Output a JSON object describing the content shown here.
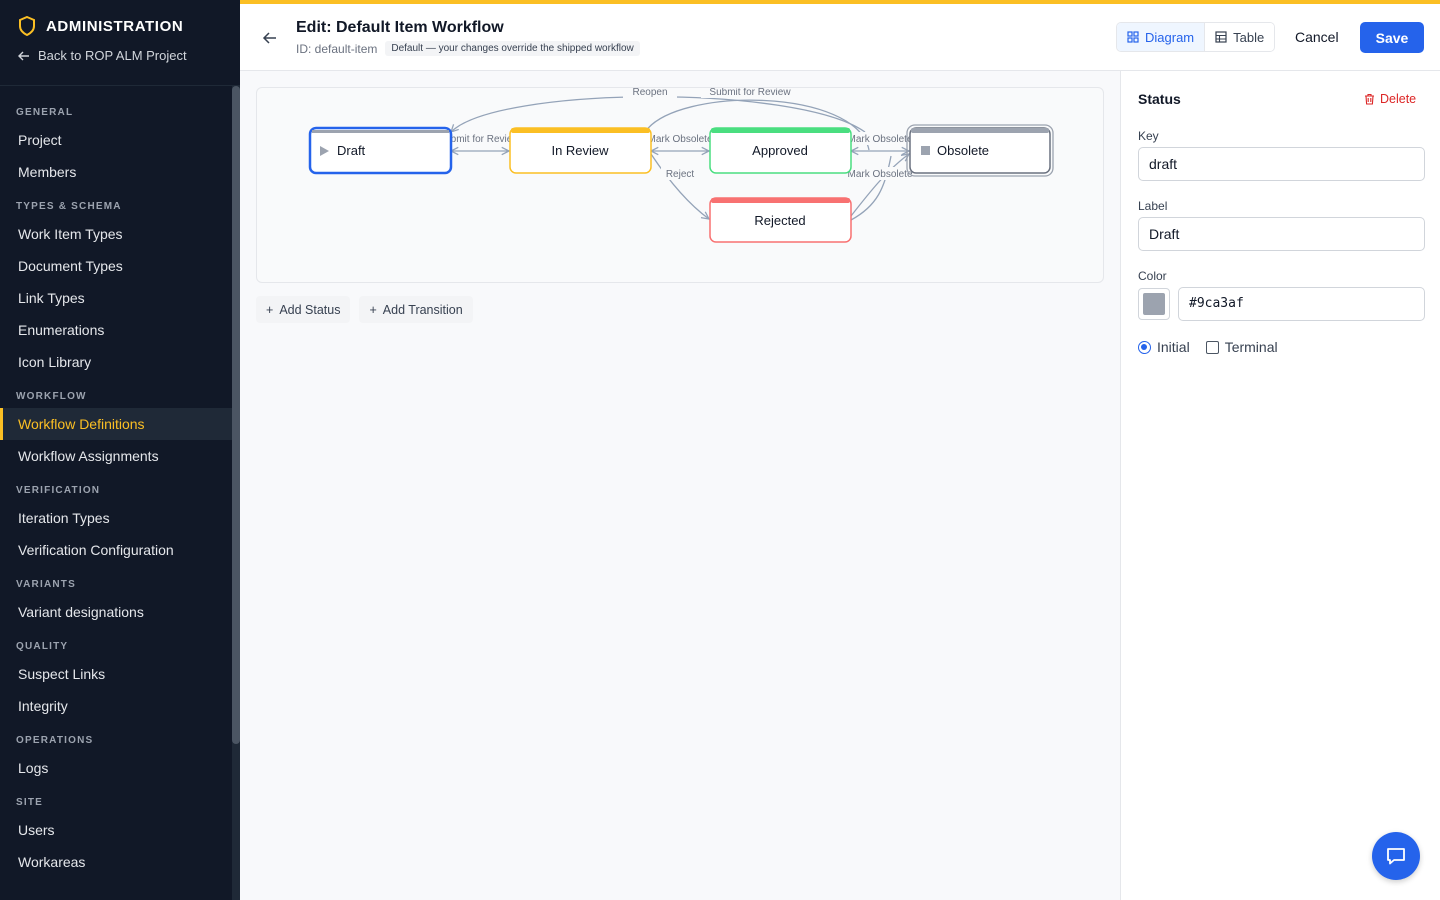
{
  "sidebar": {
    "title": "ADMINISTRATION",
    "back_label": "Back to ROP ALM Project",
    "sections": [
      {
        "title": "GENERAL",
        "items": [
          {
            "label": "Project"
          },
          {
            "label": "Members"
          }
        ]
      },
      {
        "title": "TYPES & SCHEMA",
        "items": [
          {
            "label": "Work Item Types"
          },
          {
            "label": "Document Types"
          },
          {
            "label": "Link Types"
          },
          {
            "label": "Enumerations"
          },
          {
            "label": "Icon Library"
          }
        ]
      },
      {
        "title": "WORKFLOW",
        "items": [
          {
            "label": "Workflow Definitions",
            "active": true
          },
          {
            "label": "Workflow Assignments"
          }
        ]
      },
      {
        "title": "VERIFICATION",
        "items": [
          {
            "label": "Iteration Types"
          },
          {
            "label": "Verification Configuration"
          }
        ]
      },
      {
        "title": "VARIANTS",
        "items": [
          {
            "label": "Variant designations"
          }
        ]
      },
      {
        "title": "QUALITY",
        "items": [
          {
            "label": "Suspect Links"
          },
          {
            "label": "Integrity"
          }
        ]
      },
      {
        "title": "OPERATIONS",
        "items": [
          {
            "label": "Logs"
          }
        ]
      },
      {
        "title": "SITE",
        "items": [
          {
            "label": "Users"
          },
          {
            "label": "Workareas"
          }
        ]
      }
    ]
  },
  "header": {
    "title": "Edit: Default Item Workflow",
    "id_text": "ID: default-item",
    "badge": "Default — your changes override the shipped workflow",
    "view_diagram": "Diagram",
    "view_table": "Table",
    "cancel_label": "Cancel",
    "save_label": "Save"
  },
  "diagram": {
    "nodes": [
      {
        "key": "draft",
        "label": "Draft",
        "color": "#9ca3af",
        "selected": true,
        "initial": true
      },
      {
        "key": "in-review",
        "label": "In Review",
        "color": "#fbbf24"
      },
      {
        "key": "approved",
        "label": "Approved",
        "color": "#4ade80"
      },
      {
        "key": "obsolete",
        "label": "Obsolete",
        "color": "#9ca3af",
        "terminal": true
      },
      {
        "key": "rejected",
        "label": "Rejected",
        "color": "#f87171"
      }
    ],
    "edge_labels": [
      "Submit for Review",
      "Mark Obsolete",
      "Mark Obsolete",
      "Reject",
      "Mark Obsolete",
      "Reopen",
      "Submit for Review"
    ],
    "accent_color": "#2563eb"
  },
  "actions": {
    "add_status": "Add Status",
    "add_transition": "Add Transition"
  },
  "panel": {
    "title": "Status",
    "delete_label": "Delete",
    "key_label": "Key",
    "key_value": "draft",
    "label_label": "Label",
    "label_value": "Draft",
    "color_label": "Color",
    "color_value": "#9ca3af",
    "color_text": "#9ca3af",
    "initial_label": "Initial",
    "terminal_label": "Terminal",
    "initial_checked": true,
    "terminal_checked": false
  }
}
